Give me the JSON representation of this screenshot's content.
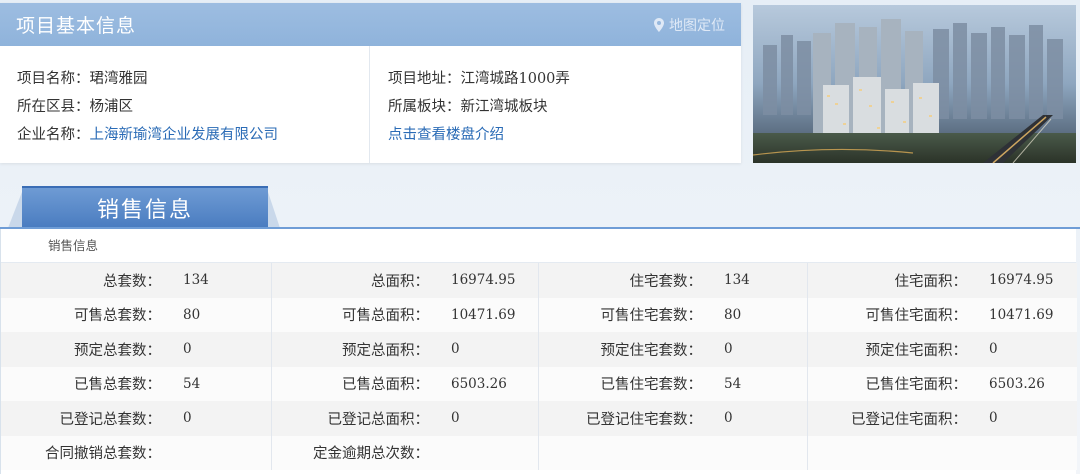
{
  "project": {
    "title": "项目基本信息",
    "map_link": "地图定位",
    "left": [
      {
        "label": "项目名称：",
        "value": "珺湾雅园",
        "link": false
      },
      {
        "label": "所在区县：",
        "value": "杨浦区",
        "link": false
      },
      {
        "label": "企业名称：",
        "value": "上海新瑜湾企业发展有限公司",
        "link": true
      }
    ],
    "right": [
      {
        "label": "项目地址：",
        "value": "江湾城路1000弄"
      },
      {
        "label": "所属板块：",
        "value": "新江湾城板块"
      }
    ],
    "intro_link": "点击查看楼盘介绍"
  },
  "sales": {
    "tab_label": "销售信息",
    "caption": "销售信息",
    "rows": [
      [
        [
          "总套数：",
          "134"
        ],
        [
          "总面积：",
          "16974.95"
        ],
        [
          "住宅套数：",
          "134"
        ],
        [
          "住宅面积：",
          "16974.95"
        ]
      ],
      [
        [
          "可售总套数：",
          "80"
        ],
        [
          "可售总面积：",
          "10471.69"
        ],
        [
          "可售住宅套数：",
          "80"
        ],
        [
          "可售住宅面积：",
          "10471.69"
        ]
      ],
      [
        [
          "预定总套数：",
          "0"
        ],
        [
          "预定总面积：",
          "0"
        ],
        [
          "预定住宅套数：",
          "0"
        ],
        [
          "预定住宅面积：",
          "0"
        ]
      ],
      [
        [
          "已售总套数：",
          "54"
        ],
        [
          "已售总面积：",
          "6503.26"
        ],
        [
          "已售住宅套数：",
          "54"
        ],
        [
          "已售住宅面积：",
          "6503.26"
        ]
      ],
      [
        [
          "已登记总套数：",
          "0"
        ],
        [
          "已登记总面积：",
          "0"
        ],
        [
          "已登记住宅套数：",
          "0"
        ],
        [
          "已登记住宅面积：",
          "0"
        ]
      ],
      [
        [
          "合同撤销总套数：",
          ""
        ],
        [
          "定金逾期总次数：",
          ""
        ],
        [
          "",
          ""
        ],
        [
          "",
          ""
        ]
      ]
    ]
  },
  "colors": {
    "header_blue": "#8fb3db",
    "tab_blue": "#4a7cc0",
    "link_blue": "#2a6bb6"
  },
  "icons": [
    "location-pin-icon"
  ]
}
